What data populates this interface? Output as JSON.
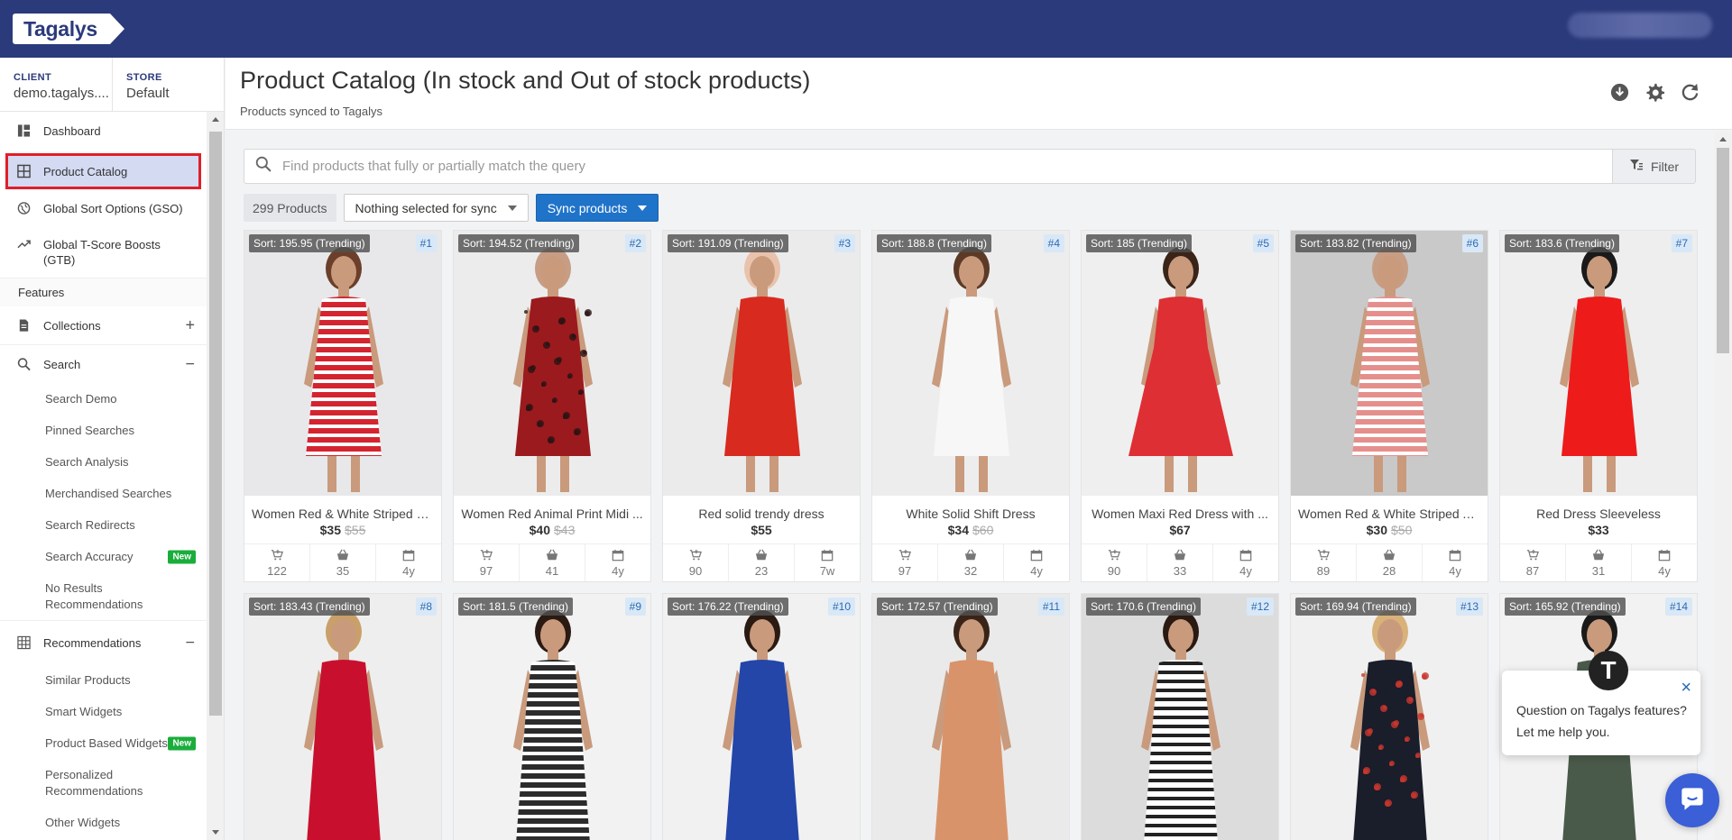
{
  "brand": {
    "logo_text": "Tagalys"
  },
  "client_store": {
    "client_label": "CLIENT",
    "client_value": "demo.tagalys....",
    "store_label": "STORE",
    "store_value": "Default"
  },
  "sidebar": {
    "main_items": [
      {
        "label": "Dashboard",
        "icon": "dashboard-icon"
      },
      {
        "label": "Product Catalog",
        "icon": "grid-icon",
        "active": true
      },
      {
        "label": "Global Sort Options (GSO)",
        "icon": "globe-icon"
      },
      {
        "label": "Global T-Score Boosts (GTB)",
        "icon": "trend-icon"
      }
    ],
    "features_label": "Features",
    "collections_label": "Collections",
    "search_label": "Search",
    "search_items": [
      "Search Demo",
      "Pinned Searches",
      "Search Analysis",
      "Merchandised Searches",
      "Search Redirects",
      "Search Accuracy",
      "No Results Recommendations"
    ],
    "new_badge": "New",
    "recommendations_label": "Recommendations",
    "recommendation_items": [
      "Similar Products",
      "Smart Widgets",
      "Product Based Widgets",
      "Personalized Recommendations",
      "Other Widgets"
    ]
  },
  "page": {
    "title": "Product Catalog (In stock and Out of stock products)",
    "subtitle": "Products synced to Tagalys"
  },
  "search": {
    "placeholder": "Find products that fully or partially match the query",
    "value": "",
    "filter_label": "Filter"
  },
  "actions": {
    "count_label": "299 Products",
    "sync_select_label": "Nothing selected for sync",
    "sync_button_label": "Sync products"
  },
  "products": [
    {
      "sort": "Sort: 195.95 (Trending)",
      "rank": "#1",
      "name": "Women Red & White Striped S...",
      "price": "$35",
      "old_price": "$55",
      "carts": "122",
      "buys": "35",
      "age": "4y",
      "colors": [
        "#e8e8ea",
        "#d42430",
        "#ffffff",
        "#6b3f2a"
      ]
    },
    {
      "sort": "Sort: 194.52 (Trending)",
      "rank": "#2",
      "name": "Women Red Animal Print Midi ...",
      "price": "$40",
      "old_price": "$43",
      "carts": "97",
      "buys": "41",
      "age": "4y",
      "colors": [
        "#ececec",
        "#9b1a1e",
        "#2a1414",
        "#c79d84"
      ]
    },
    {
      "sort": "Sort: 191.09 (Trending)",
      "rank": "#3",
      "name": "Red solid trendy dress",
      "price": "$55",
      "old_price": "",
      "carts": "90",
      "buys": "23",
      "age": "7w",
      "colors": [
        "#ebebeb",
        "#d82a1e",
        "#d82a1e",
        "#e9c2ab"
      ]
    },
    {
      "sort": "Sort: 188.8 (Trending)",
      "rank": "#4",
      "name": "White Solid Shift Dress",
      "price": "$34",
      "old_price": "$60",
      "carts": "97",
      "buys": "32",
      "age": "4y",
      "colors": [
        "#ededed",
        "#f7f7f7",
        "#f7f7f7",
        "#5c3a26"
      ]
    },
    {
      "sort": "Sort: 185 (Trending)",
      "rank": "#5",
      "name": "Women Maxi Red Dress with ...",
      "price": "$67",
      "old_price": "",
      "carts": "90",
      "buys": "33",
      "age": "4y",
      "colors": [
        "#efefef",
        "#de2f34",
        "#de2f34",
        "#3a2418"
      ]
    },
    {
      "sort": "Sort: 183.82 (Trending)",
      "rank": "#6",
      "name": "Women Red & White Striped A...",
      "price": "$30",
      "old_price": "$50",
      "carts": "89",
      "buys": "28",
      "age": "4y",
      "colors": [
        "#c9c9c9",
        "#e58f8c",
        "#ffffff",
        "#c79d84"
      ]
    },
    {
      "sort": "Sort: 183.6 (Trending)",
      "rank": "#7",
      "name": "Red Dress Sleeveless",
      "price": "$33",
      "old_price": "",
      "carts": "87",
      "buys": "31",
      "age": "4y",
      "colors": [
        "#eeeeee",
        "#ee1b1b",
        "#ee1b1b",
        "#1a1a1a"
      ]
    },
    {
      "sort": "Sort: 183.43 (Trending)",
      "rank": "#8",
      "name": "",
      "price": "",
      "old_price": "",
      "carts": "",
      "buys": "",
      "age": "",
      "colors": [
        "#eeeeee",
        "#c8102e",
        "#ffffff",
        "#c9a06a"
      ]
    },
    {
      "sort": "Sort: 181.5 (Trending)",
      "rank": "#9",
      "name": "",
      "price": "",
      "old_price": "",
      "carts": "",
      "buys": "",
      "age": "",
      "colors": [
        "#f2f2f2",
        "#2c2c2c",
        "#ffffff",
        "#2a1a12"
      ]
    },
    {
      "sort": "Sort: 176.22 (Trending)",
      "rank": "#10",
      "name": "",
      "price": "",
      "old_price": "",
      "carts": "",
      "buys": "",
      "age": "",
      "colors": [
        "#f1f1f1",
        "#2346a8",
        "#2346a8",
        "#2a1a12"
      ]
    },
    {
      "sort": "Sort: 172.57 (Trending)",
      "rank": "#11",
      "name": "",
      "price": "",
      "old_price": "",
      "carts": "",
      "buys": "",
      "age": "",
      "colors": [
        "#eaeaea",
        "#d9936a",
        "#d9936a",
        "#3a2418"
      ]
    },
    {
      "sort": "Sort: 170.6 (Trending)",
      "rank": "#12",
      "name": "",
      "price": "",
      "old_price": "",
      "carts": "",
      "buys": "",
      "age": "",
      "colors": [
        "#dcdcdc",
        "#ffffff",
        "#222222",
        "#2a1a12"
      ]
    },
    {
      "sort": "Sort: 169.94 (Trending)",
      "rank": "#13",
      "name": "",
      "price": "",
      "old_price": "",
      "carts": "",
      "buys": "",
      "age": "",
      "colors": [
        "#f0f0f0",
        "#1a1d2a",
        "#c8372d",
        "#d9b27a"
      ]
    },
    {
      "sort": "Sort: 165.92 (Trending)",
      "rank": "#14",
      "name": "",
      "price": "",
      "old_price": "",
      "carts": "",
      "buys": "",
      "age": "",
      "colors": [
        "#f2f2f2",
        "#4a5a4a",
        "#e8e8e8",
        "#1a1a1a"
      ]
    }
  ],
  "chat": {
    "avatar_letter": "T",
    "line1": "Question on Tagalys features?",
    "line2": "Let me help you.",
    "close_glyph": "×"
  }
}
